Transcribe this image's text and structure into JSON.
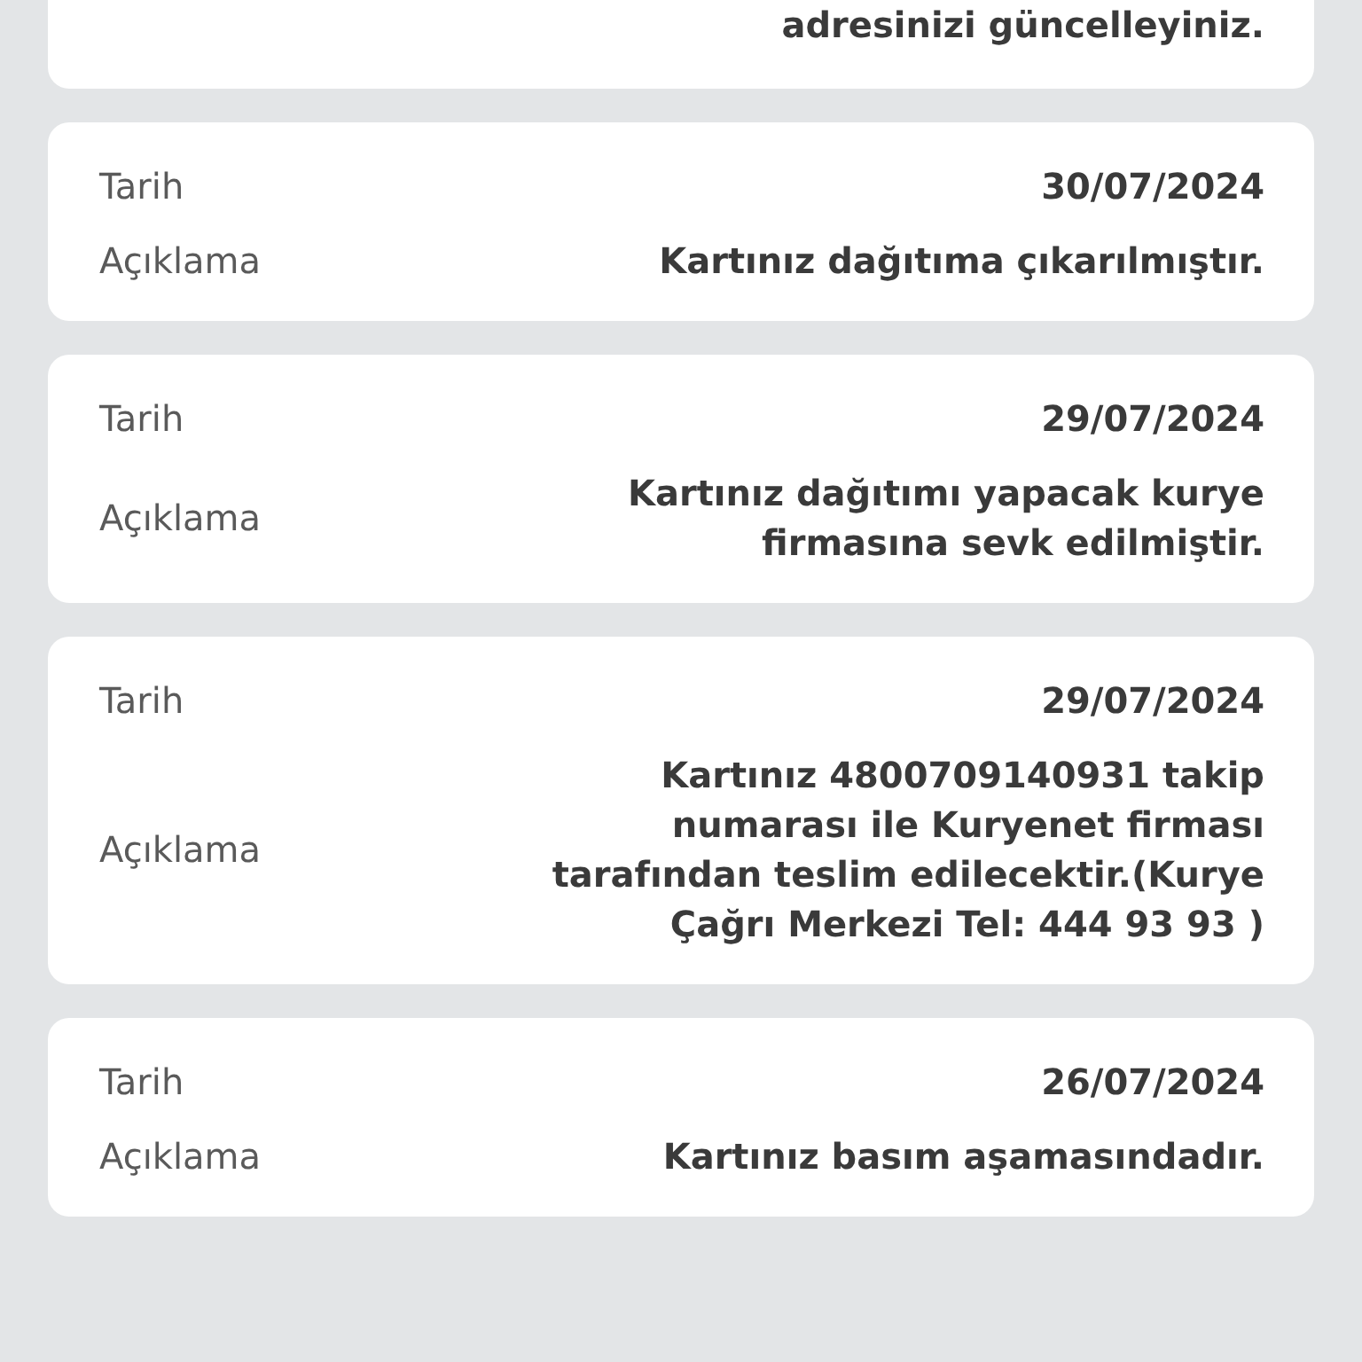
{
  "top_card": {
    "description": "adresinizi güncelleyiniz."
  },
  "records": [
    {
      "date_label": "Tarih",
      "date": "30/07/2024",
      "description_label": "Açıklama",
      "description": "Kartınız dağıtıma çıkarılmıştır."
    },
    {
      "date_label": "Tarih",
      "date": "29/07/2024",
      "description_label": "Açıklama",
      "description": "Kartınız dağıtımı yapacak kurye firmasına sevk edilmiştir."
    },
    {
      "date_label": "Tarih",
      "date": "29/07/2024",
      "description_label": "Açıklama",
      "description": "Kartınız 4800709140931 takip numarası ile Kuryenet firması tarafından teslim edilecektir.(Kurye Çağrı Merkezi Tel: 444 93 93 )"
    },
    {
      "date_label": "Tarih",
      "date": "26/07/2024",
      "description_label": "Açıklama",
      "description": "Kartınız basım aşamasındadır."
    }
  ]
}
